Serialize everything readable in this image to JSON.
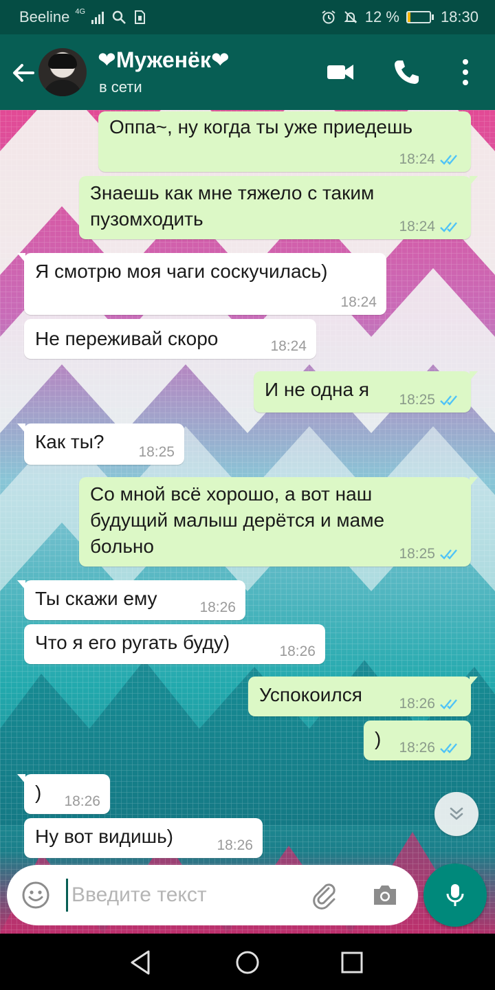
{
  "status_bar": {
    "carrier": "Beeline",
    "network": "4G",
    "battery_percent": "12 %",
    "battery_level": 0.12,
    "time": "18:30",
    "icons": [
      "signal-icon",
      "search-icon",
      "sim-icon",
      "alarm-icon",
      "mute-icon",
      "battery-icon"
    ]
  },
  "header": {
    "contact_name": "❤Муженёк❤",
    "status": "в сети",
    "icons": [
      "back-arrow-icon",
      "avatar",
      "video-call-icon",
      "phone-icon",
      "more-vertical-icon"
    ]
  },
  "messages": [
    {
      "direction": "out",
      "text": "Оппа~, ну когда ты уже приедешь",
      "time": "18:24",
      "read": true
    },
    {
      "direction": "out",
      "text": "Знаешь как мне тяжело с таким пузомходить",
      "line1": "Знаешь как мне тяжело с таким",
      "line2": "пузомходить",
      "time": "18:24",
      "read": true
    },
    {
      "direction": "in",
      "text": "Я смотрю моя чаги соскучилась)",
      "time": "18:24"
    },
    {
      "direction": "in",
      "text": "Не переживай скоро",
      "time": "18:24"
    },
    {
      "direction": "out",
      "text": "И не одна я",
      "time": "18:25",
      "read": true
    },
    {
      "direction": "in",
      "text": "Как ты?",
      "time": "18:25"
    },
    {
      "direction": "out",
      "text": "Со мной всё хорошо, а вот наш будущий малыш дерётся и маме больно",
      "line1": "Со мной всё хорошо, а вот наш",
      "line2": "будущий малыш дерётся и маме",
      "line3": "больно",
      "time": "18:25",
      "read": true
    },
    {
      "direction": "in",
      "text": "Ты скажи ему",
      "time": "18:26"
    },
    {
      "direction": "in",
      "text": "Что я его ругать буду)",
      "time": "18:26"
    },
    {
      "direction": "out",
      "text": "Успокоился",
      "time": "18:26",
      "read": true
    },
    {
      "direction": "out",
      "text": ")",
      "time": "18:26",
      "read": true
    },
    {
      "direction": "in",
      "text": ")",
      "time": "18:26"
    },
    {
      "direction": "in",
      "text": "Ну вот видишь)",
      "time": "18:26"
    }
  ],
  "input": {
    "placeholder": "Введите текст",
    "icons": [
      "emoji-icon",
      "attach-icon",
      "camera-icon",
      "mic-icon"
    ]
  },
  "colors": {
    "header": "#075e54",
    "status_bar": "#054d44",
    "outgoing_bubble": "#dcf8c6",
    "incoming_bubble": "#ffffff",
    "read_tick": "#4fc3f7",
    "mic_button": "#00897b"
  },
  "nav_bar": {
    "icons": [
      "nav-back-icon",
      "nav-home-icon",
      "nav-recent-icon"
    ]
  }
}
